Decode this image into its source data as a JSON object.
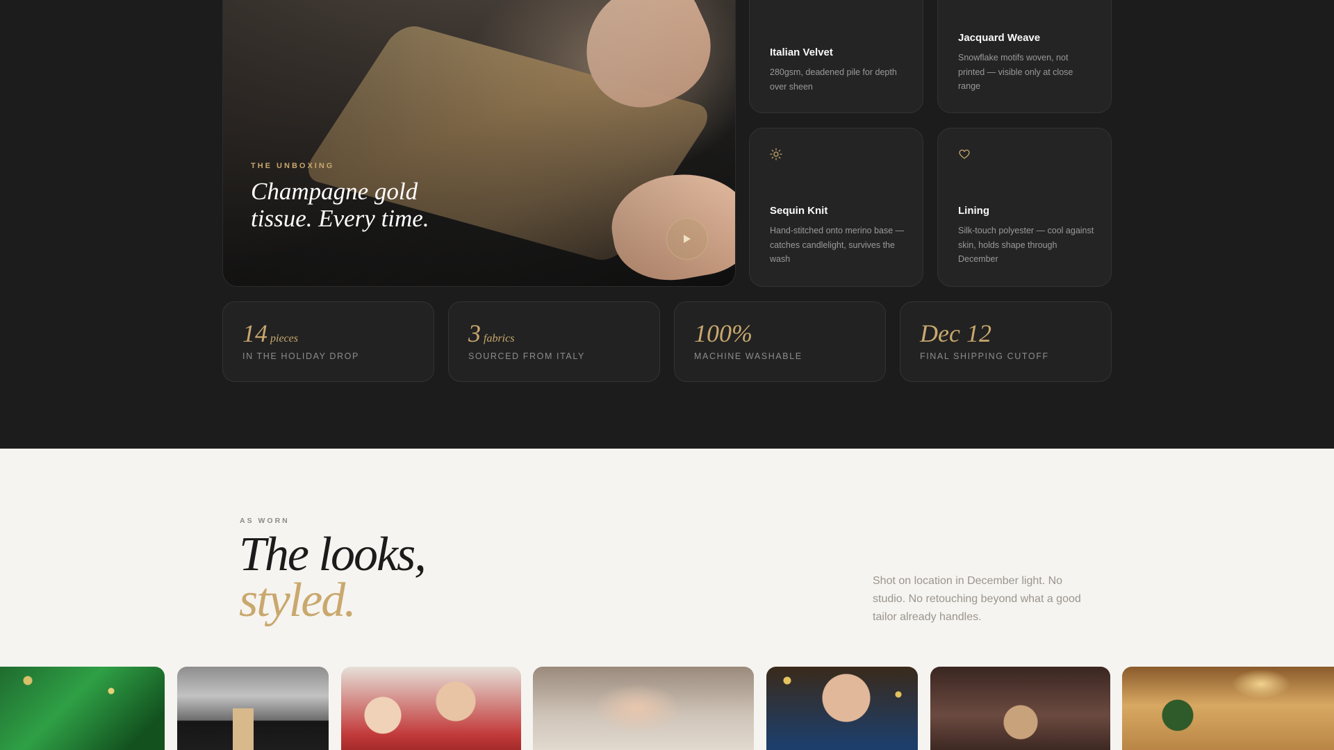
{
  "hero": {
    "eyebrow": "THE UNBOXING",
    "title": "Champagne gold tissue. Every time.",
    "play_icon": "play-icon"
  },
  "fabrics": [
    {
      "name": "Italian Velvet",
      "desc": "280gsm, deadened pile for depth over sheen",
      "icon": ""
    },
    {
      "name": "Jacquard Weave",
      "desc": "Snowflake motifs woven, not printed — visible only at close range",
      "icon": ""
    },
    {
      "name": "Sequin Knit",
      "desc": "Hand-stitched onto merino base — catches candlelight, survives the wash",
      "icon": "sparkle-icon"
    },
    {
      "name": "Lining",
      "desc": "Silk-touch polyester — cool against skin, holds shape through December",
      "icon": "heart-icon"
    }
  ],
  "stats": [
    {
      "value": "14",
      "unit": "pieces",
      "label": "IN THE HOLIDAY DROP"
    },
    {
      "value": "3",
      "unit": "fabrics",
      "label": "SOURCED FROM ITALY"
    },
    {
      "value": "100%",
      "unit": "",
      "label": "MACHINE WASHABLE"
    },
    {
      "value": "Dec 12",
      "unit": "",
      "label": "FINAL SHIPPING CUTOFF"
    }
  ],
  "as_worn": {
    "eyebrow": "AS WORN",
    "title_line1": "The looks,",
    "title_line2": "styled.",
    "description": "Shot on location in December light. No studio. No retouching beyond what a good tailor already handles."
  },
  "colors": {
    "accent": "#c9a86e",
    "dark_bg": "#1c1c1c",
    "light_bg": "#f6f4f0"
  }
}
